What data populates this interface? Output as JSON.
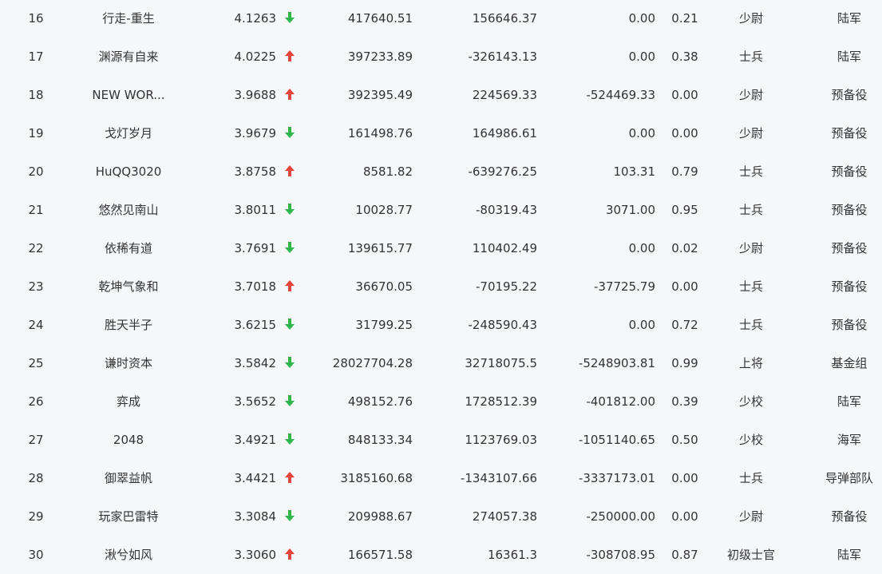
{
  "colors": {
    "up": "#e8453c",
    "down": "#31b44b",
    "text": "#333333",
    "background": "#f6f7f9"
  },
  "rows": [
    {
      "rank": "16",
      "name": "行走-重生",
      "score": "4.1263",
      "trend": "down",
      "v1": "417640.51",
      "v2": "156646.37",
      "v3": "0.00",
      "ratio": "0.21",
      "title": "少尉",
      "branch": "陆军"
    },
    {
      "rank": "17",
      "name": "渊源有自来",
      "score": "4.0225",
      "trend": "up",
      "v1": "397233.89",
      "v2": "-326143.13",
      "v3": "0.00",
      "ratio": "0.38",
      "title": "士兵",
      "branch": "陆军"
    },
    {
      "rank": "18",
      "name": "NEW WOR...",
      "score": "3.9688",
      "trend": "up",
      "v1": "392395.49",
      "v2": "224569.33",
      "v3": "-524469.33",
      "ratio": "0.00",
      "title": "少尉",
      "branch": "预备役"
    },
    {
      "rank": "19",
      "name": "戈灯岁月",
      "score": "3.9679",
      "trend": "down",
      "v1": "161498.76",
      "v2": "164986.61",
      "v3": "0.00",
      "ratio": "0.00",
      "title": "少尉",
      "branch": "预备役"
    },
    {
      "rank": "20",
      "name": "HuQQ3020",
      "score": "3.8758",
      "trend": "up",
      "v1": "8581.82",
      "v2": "-639276.25",
      "v3": "103.31",
      "ratio": "0.79",
      "title": "士兵",
      "branch": "预备役"
    },
    {
      "rank": "21",
      "name": "悠然见南山",
      "score": "3.8011",
      "trend": "down",
      "v1": "10028.77",
      "v2": "-80319.43",
      "v3": "3071.00",
      "ratio": "0.95",
      "title": "士兵",
      "branch": "预备役"
    },
    {
      "rank": "22",
      "name": "依稀有道",
      "score": "3.7691",
      "trend": "down",
      "v1": "139615.77",
      "v2": "110402.49",
      "v3": "0.00",
      "ratio": "0.02",
      "title": "少尉",
      "branch": "预备役"
    },
    {
      "rank": "23",
      "name": "乾坤气象和",
      "score": "3.7018",
      "trend": "up",
      "v1": "36670.05",
      "v2": "-70195.22",
      "v3": "-37725.79",
      "ratio": "0.00",
      "title": "士兵",
      "branch": "预备役"
    },
    {
      "rank": "24",
      "name": "胜天半子",
      "score": "3.6215",
      "trend": "down",
      "v1": "31799.25",
      "v2": "-248590.43",
      "v3": "0.00",
      "ratio": "0.72",
      "title": "士兵",
      "branch": "预备役"
    },
    {
      "rank": "25",
      "name": "谦时资本",
      "score": "3.5842",
      "trend": "down",
      "v1": "28027704.28",
      "v2": "32718075.5",
      "v3": "-5248903.81",
      "ratio": "0.99",
      "title": "上将",
      "branch": "基金组"
    },
    {
      "rank": "26",
      "name": "弈成",
      "score": "3.5652",
      "trend": "down",
      "v1": "498152.76",
      "v2": "1728512.39",
      "v3": "-401812.00",
      "ratio": "0.39",
      "title": "少校",
      "branch": "陆军"
    },
    {
      "rank": "27",
      "name": "2048",
      "score": "3.4921",
      "trend": "down",
      "v1": "848133.34",
      "v2": "1123769.03",
      "v3": "-1051140.65",
      "ratio": "0.50",
      "title": "少校",
      "branch": "海军"
    },
    {
      "rank": "28",
      "name": "御翠益帆",
      "score": "3.4421",
      "trend": "up",
      "v1": "3185160.68",
      "v2": "-1343107.66",
      "v3": "-3337173.01",
      "ratio": "0.00",
      "title": "士兵",
      "branch": "导弹部队"
    },
    {
      "rank": "29",
      "name": "玩家巴雷特",
      "score": "3.3084",
      "trend": "down",
      "v1": "209988.67",
      "v2": "274057.38",
      "v3": "-250000.00",
      "ratio": "0.00",
      "title": "少尉",
      "branch": "预备役"
    },
    {
      "rank": "30",
      "name": "湫兮如风",
      "score": "3.3060",
      "trend": "up",
      "v1": "166571.58",
      "v2": "16361.3",
      "v3": "-308708.95",
      "ratio": "0.87",
      "title": "初级士官",
      "branch": "陆军"
    }
  ]
}
